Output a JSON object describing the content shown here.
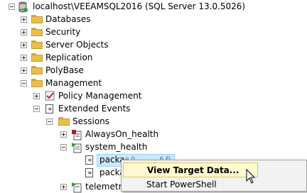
{
  "tree": {
    "server": "localhost\\VEEAMSQL2016 (SQL Server 13.0.5026)",
    "databases": "Databases",
    "security": "Security",
    "server_objects": "Server Objects",
    "replication": "Replication",
    "polybase": "PolyBase",
    "management": "Management",
    "policy_management": "Policy Management",
    "extended_events": "Extended Events",
    "sessions": "Sessions",
    "alwayson_health": "AlwaysOn_health",
    "system_health": "system_health",
    "target1": "packa",
    "target1_tail": "e 0 . . . . . .6 Fi",
    "target2": "packa",
    "telemetry": "telemetry"
  },
  "context_menu": {
    "view_target_data": "View Target Data...",
    "start_powershell": "Start PowerShell"
  },
  "colors": {
    "selection": "#cce8ff",
    "menu_highlight": "#fffacd",
    "folder": "#e8bf4f"
  }
}
